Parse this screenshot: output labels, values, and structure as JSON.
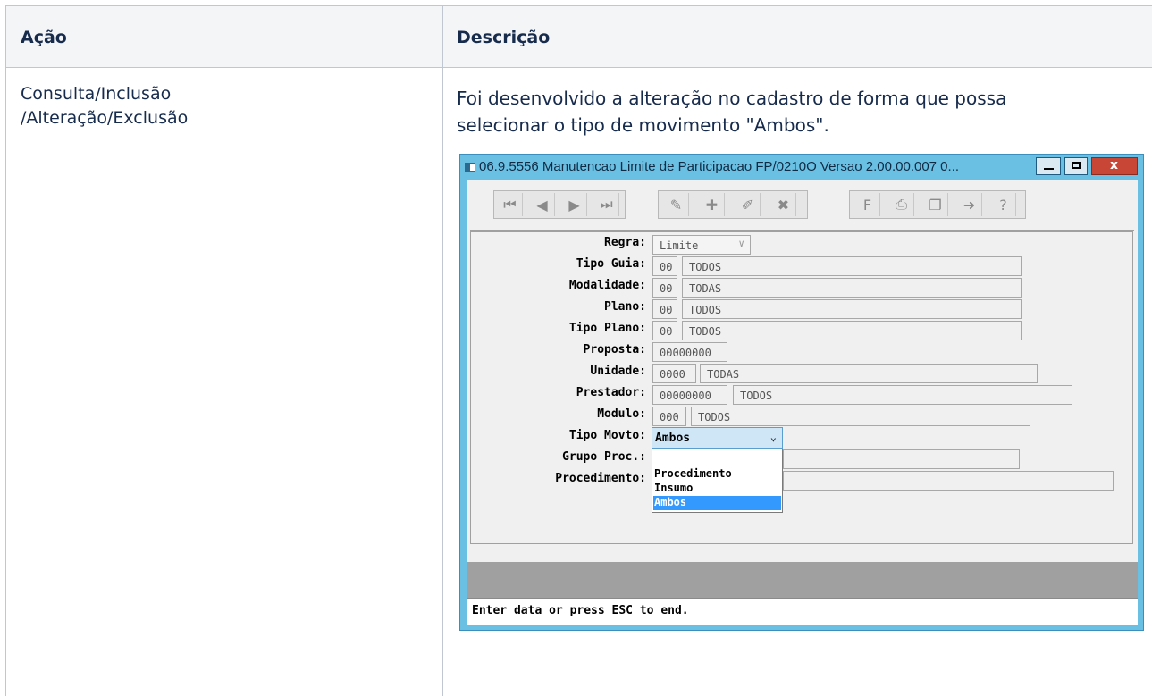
{
  "table": {
    "headers": {
      "action": "Ação",
      "description": "Descrição"
    },
    "row": {
      "action_line1": "Consulta/Inclusão",
      "action_line2": "/Alteração/Exclusão",
      "description_line1": "Foi desenvolvido a alteração no cadastro de forma que possa",
      "description_line2": "selecionar o tipo de movimento \"Ambos\"."
    }
  },
  "window": {
    "title": "06.9.5556 Manutencao  Limite de Participacao FP/0210O Versao 2.00.00.007 0...",
    "close_glyph": "x",
    "toolbar": {
      "nav": [
        "first-record-icon",
        "previous-record-icon",
        "next-record-icon",
        "last-record-icon"
      ],
      "edit": [
        "query-icon",
        "add-icon",
        "edit-icon",
        "delete-icon"
      ],
      "misc": [
        "filter-icon",
        "print-icon",
        "copy-icon",
        "exit-icon",
        "help-icon"
      ]
    },
    "form": {
      "regra": {
        "label": "Regra:",
        "value": "Limite"
      },
      "tipo_guia": {
        "label": "Tipo Guia:",
        "code": "00",
        "desc": "TODOS"
      },
      "modalidade": {
        "label": "Modalidade:",
        "code": "00",
        "desc": "TODAS"
      },
      "plano": {
        "label": "Plano:",
        "code": "00",
        "desc": "TODOS"
      },
      "tipo_plano": {
        "label": "Tipo Plano:",
        "code": "00",
        "desc": "TODOS"
      },
      "proposta": {
        "label": "Proposta:",
        "code": "00000000"
      },
      "unidade": {
        "label": "Unidade:",
        "code": "0000",
        "desc": "TODAS"
      },
      "prestador": {
        "label": "Prestador:",
        "code": "00000000",
        "desc": "TODOS"
      },
      "modulo": {
        "label": "Modulo:",
        "code": "000",
        "desc": "TODOS"
      },
      "tipo_movto": {
        "label": "Tipo Movto:",
        "value": "Ambos",
        "options": [
          "Procedimento",
          "Insumo",
          "Ambos"
        ],
        "selected": "Ambos"
      },
      "grupo_proc": {
        "label": "Grupo Proc.:"
      },
      "procedimento": {
        "label": "Procedimento:"
      }
    },
    "status_text": "Enter data or press ESC to end."
  }
}
